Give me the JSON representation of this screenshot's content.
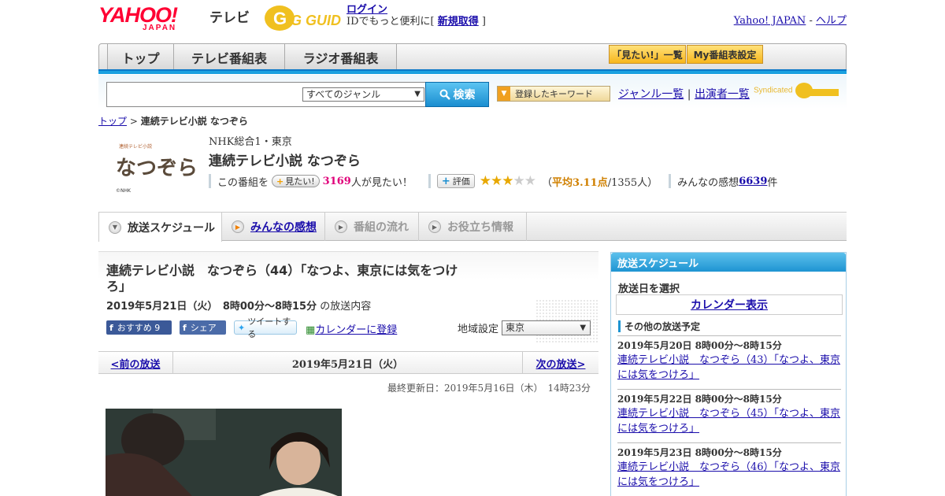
{
  "header": {
    "logo_yahoo": "YAHOO!",
    "logo_japan": "JAPAN",
    "logo_tv": "テレビ",
    "gguide_logo": "G GUIDE",
    "login_link": "ログイン",
    "login_text": "IDでもっと便利に[ ",
    "register_link": "新規取得",
    "login_text_end": " ]",
    "yahoo_japan_link": "Yahoo! JAPAN",
    "separator": " - ",
    "help_link": "ヘルプ"
  },
  "nav": {
    "tabs": [
      "トップ",
      "テレビ番組表",
      "ラジオ番組表"
    ],
    "mitai_list": "「見たい!」一覧",
    "my_schedule": "My番組表設定"
  },
  "search": {
    "genre": "すべてのジャンル",
    "button": "検索",
    "keyword_button": "登録したキーワード",
    "genre_list": "ジャンル一覧",
    "pipe": " | ",
    "cast_list": "出演者一覧",
    "syndicated": "Syndicated"
  },
  "breadcrumb": {
    "top": "トップ",
    "sep": " > ",
    "current": "連続テレビ小説 なつぞら"
  },
  "program": {
    "logo_text": "なつぞら",
    "logo_sub": "連続テレビ小説",
    "copyright": "©NHK",
    "channel": "NHK総合1・東京",
    "title": "連続テレビ小説 なつぞら",
    "this_program": "この番組を",
    "mitai_btn": "見たい!",
    "mitai_count": "3169",
    "mitai_suffix": "人が見たい！",
    "rate_btn": "評価",
    "rating_stars": 3,
    "avg_open": "（",
    "avg_label": "平均3.11点",
    "avg_count": "/1355人）",
    "impressions_label": "みんなの感想 ",
    "impressions_count": "6639",
    "impressions_suffix": "件"
  },
  "subtabs": [
    "放送スケジュール",
    "みんなの感想",
    "番組の流れ",
    "お役立ち情報"
  ],
  "episode": {
    "title": "連続テレビ小説　なつぞら（44）「なつよ、東京には気をつけろ」",
    "date": "2019年5月21日（火）　8時00分～8時15分",
    "date_suffix": "の放送内容",
    "fb_recommend": "おすすめ 9",
    "fb_share": "シェア",
    "tweet": "ツイートする",
    "calendar_register": "カレンダーに登録",
    "region_label": "地域設定",
    "region_value": "東京",
    "prev": "<前の放送",
    "current_date": "2019年5月21日（火）",
    "next": "次の放送>",
    "updated": "最終更新日：2019年5月16日（木）　14時23分"
  },
  "sidebar": {
    "title": "放送スケジュール",
    "select_date": "放送日を選択",
    "calendar_btn": "カレンダー表示",
    "other_head": "その他の放送予定",
    "items": [
      {
        "datetime": "2019年5月20日  8時00分～8時15分",
        "title": "連続テレビ小説　なつぞら（43）「なつよ、東京には気をつけろ」"
      },
      {
        "datetime": "2019年5月22日  8時00分～8時15分",
        "title": "連続テレビ小説　なつぞら（45）「なつよ、東京には気をつけろ」"
      },
      {
        "datetime": "2019年5月23日  8時00分～8時15分",
        "title": "連続テレビ小説　なつぞら（46）「なつよ、東京には気をつけろ」"
      }
    ]
  },
  "colors": {
    "accent_blue": "#1e94d2",
    "yahoo_red": "#ff0033",
    "mitai_pink": "#e0007a",
    "rating_orange": "#d08000"
  }
}
